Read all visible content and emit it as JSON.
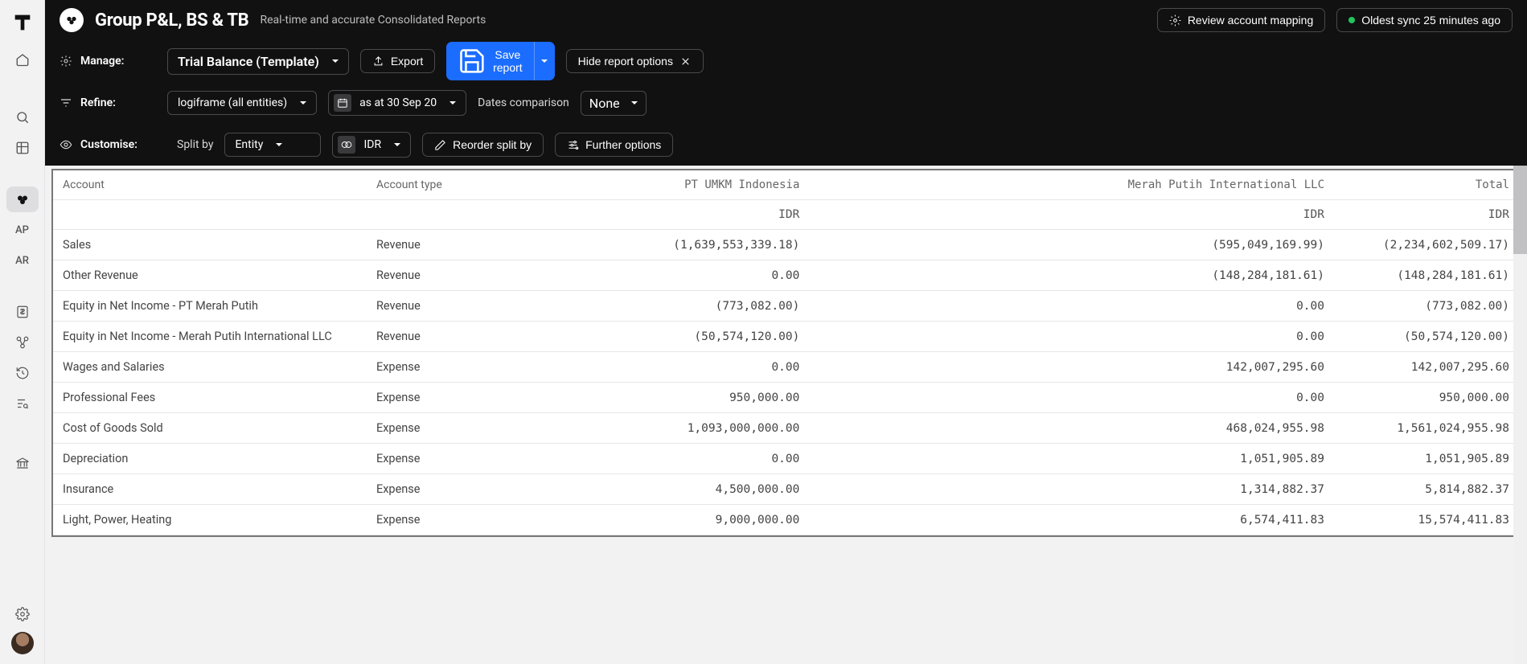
{
  "header": {
    "title": "Group P&L, BS & TB",
    "subtitle": "Real-time and accurate Consolidated Reports",
    "review_btn": "Review account mapping",
    "sync_status": "Oldest sync 25 minutes ago"
  },
  "manage": {
    "label": "Manage:",
    "report": "Trial Balance (Template)",
    "export": "Export",
    "save": "Save report",
    "hide_opts": "Hide report options"
  },
  "refine": {
    "label": "Refine:",
    "scope": "logiframe (all entities)",
    "date": "as at 30 Sep 20",
    "dates_cmp_label": "Dates comparison",
    "dates_cmp": "None"
  },
  "customise": {
    "label": "Customise:",
    "split_label": "Split by",
    "split_value": "Entity",
    "currency": "IDR",
    "reorder": "Reorder split by",
    "further": "Further options"
  },
  "table": {
    "headers": {
      "account": "Account",
      "type": "Account type",
      "col1": "PT UMKM Indonesia",
      "col2": "Merah Putih International LLC",
      "total": "Total"
    },
    "currency_row": {
      "col1": "IDR",
      "col2": "IDR",
      "total": "IDR"
    },
    "rows": [
      {
        "account": "Sales",
        "type": "Revenue",
        "c1": "(1,639,553,339.18)",
        "c2": "(595,049,169.99)",
        "t": "(2,234,602,509.17)"
      },
      {
        "account": "Other Revenue",
        "type": "Revenue",
        "c1": "0.00",
        "c2": "(148,284,181.61)",
        "t": "(148,284,181.61)"
      },
      {
        "account": "Equity in Net Income - PT Merah Putih",
        "type": "Revenue",
        "c1": "(773,082.00)",
        "c2": "0.00",
        "t": "(773,082.00)"
      },
      {
        "account": "Equity in Net Income - Merah Putih International LLC",
        "type": "Revenue",
        "c1": "(50,574,120.00)",
        "c2": "0.00",
        "t": "(50,574,120.00)"
      },
      {
        "account": "Wages and Salaries",
        "type": "Expense",
        "c1": "0.00",
        "c2": "142,007,295.60",
        "t": "142,007,295.60"
      },
      {
        "account": "Professional Fees",
        "type": "Expense",
        "c1": "950,000.00",
        "c2": "0.00",
        "t": "950,000.00"
      },
      {
        "account": "Cost of Goods Sold",
        "type": "Expense",
        "c1": "1,093,000,000.00",
        "c2": "468,024,955.98",
        "t": "1,561,024,955.98"
      },
      {
        "account": "Depreciation",
        "type": "Expense",
        "c1": "0.00",
        "c2": "1,051,905.89",
        "t": "1,051,905.89"
      },
      {
        "account": "Insurance",
        "type": "Expense",
        "c1": "4,500,000.00",
        "c2": "1,314,882.37",
        "t": "5,814,882.37"
      },
      {
        "account": "Light, Power, Heating",
        "type": "Expense",
        "c1": "9,000,000.00",
        "c2": "6,574,411.83",
        "t": "15,574,411.83"
      }
    ]
  },
  "sidebar": {
    "ap": "AP",
    "ar": "AR"
  }
}
